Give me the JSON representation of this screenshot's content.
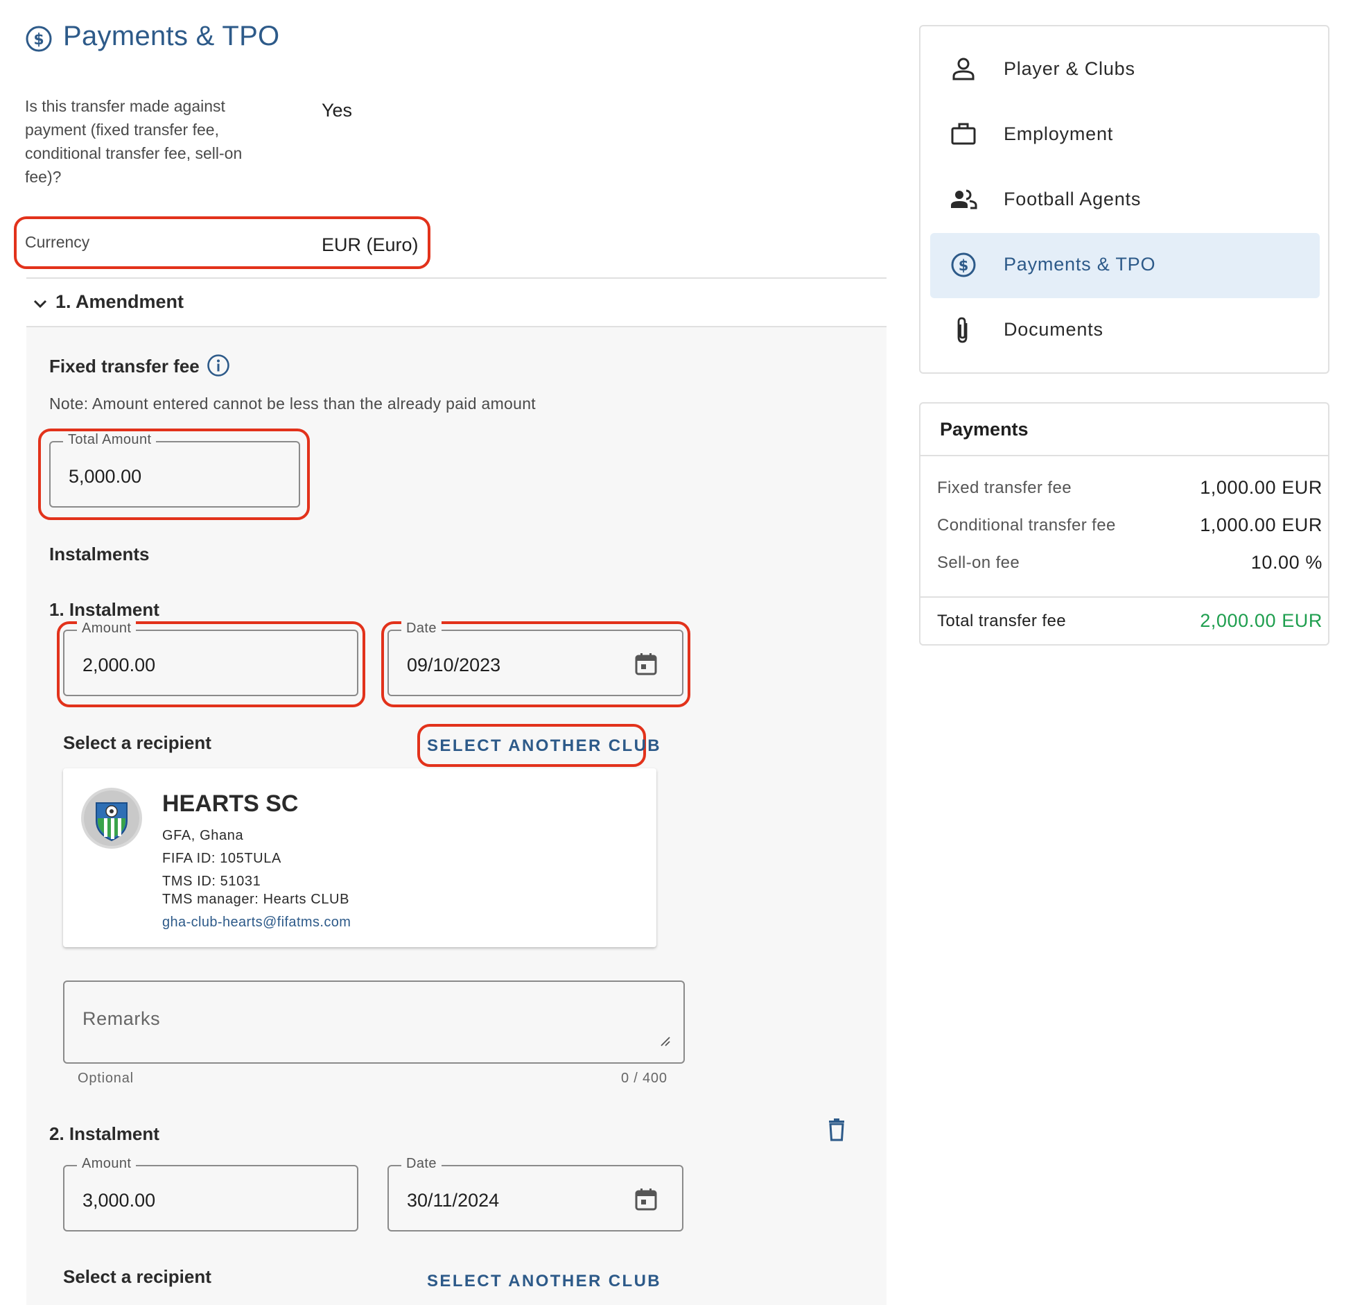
{
  "page_title": "Payments & TPO",
  "question": {
    "label": "Is this transfer made against payment (fixed transfer fee, conditional transfer fee, sell-on fee)?",
    "value": "Yes"
  },
  "currency": {
    "label": "Currency",
    "value": "EUR (Euro)"
  },
  "amendment": {
    "title": "1. Amendment",
    "fixed_fee_title": "Fixed transfer fee",
    "note": "Note: Amount entered cannot be less than the already paid amount",
    "total_amount": {
      "label": "Total Amount",
      "value": "5,000.00"
    },
    "instalments_title": "Instalments",
    "instalments": [
      {
        "title": "1. Instalment",
        "amount_label": "Amount",
        "amount": "2,000.00",
        "date_label": "Date",
        "date": "09/10/2023",
        "recipient_label": "Select a recipient",
        "select_button": "SELECT ANOTHER CLUB",
        "club": {
          "name": "HEARTS SC",
          "association": "GFA, Ghana",
          "fifa_id": "FIFA ID: 105TULA",
          "tms_id": "TMS ID: 51031",
          "manager": "TMS manager: Hearts CLUB",
          "email": "gha-club-hearts@fifatms.com"
        },
        "remarks_placeholder": "Remarks",
        "remarks_hint": "Optional",
        "remarks_count": "0 / 400"
      },
      {
        "title": "2. Instalment",
        "amount_label": "Amount",
        "amount": "3,000.00",
        "date_label": "Date",
        "date": "30/11/2024",
        "recipient_label": "Select a recipient",
        "select_button": "SELECT ANOTHER CLUB"
      }
    ]
  },
  "sidebar": {
    "items": [
      {
        "label": "Player & Clubs",
        "icon": "person-icon",
        "active": false
      },
      {
        "label": "Employment",
        "icon": "briefcase-icon",
        "active": false
      },
      {
        "label": "Football Agents",
        "icon": "people-icon",
        "active": false
      },
      {
        "label": "Payments & TPO",
        "icon": "dollar-circle-icon",
        "active": true
      },
      {
        "label": "Documents",
        "icon": "paperclip-icon",
        "active": false
      }
    ]
  },
  "payments_summary": {
    "title": "Payments",
    "rows": [
      {
        "label": "Fixed transfer fee",
        "value": "1,000.00 EUR"
      },
      {
        "label": "Conditional transfer fee",
        "value": "1,000.00 EUR"
      },
      {
        "label": "Sell-on fee",
        "value": "10.00 %"
      }
    ],
    "total_label": "Total transfer fee",
    "total_value": "2,000.00 EUR"
  },
  "colors": {
    "primary": "#2d5a89",
    "highlight": "#e2321b",
    "active_bg": "#e4eef8",
    "total_green": "#1e9e4e"
  }
}
